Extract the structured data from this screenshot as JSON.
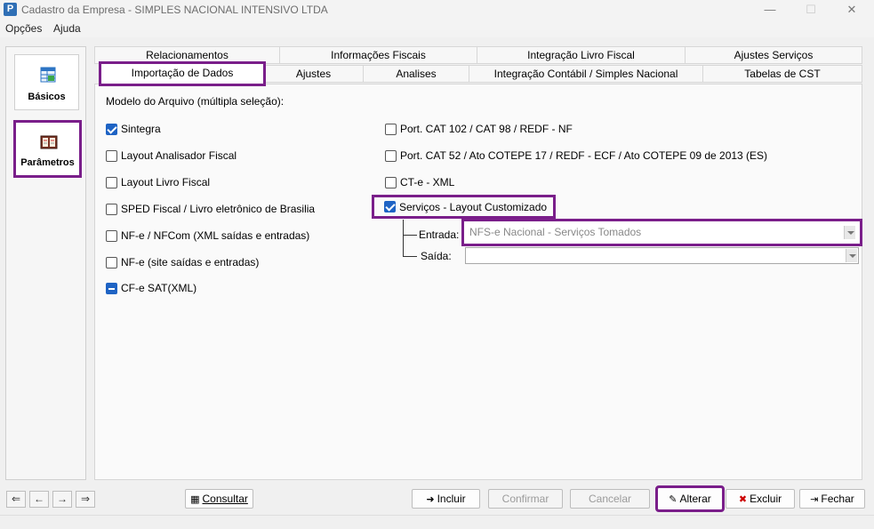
{
  "window": {
    "title": "Cadastro da Empresa - SIMPLES NACIONAL INTENSIVO LTDA",
    "app_icon_letter": "P",
    "minimize": "—",
    "maximize": "☐",
    "close": "✕"
  },
  "menu": {
    "items": [
      "Opções",
      "Ajuda"
    ]
  },
  "sidebar": {
    "items": [
      {
        "label": "Básicos",
        "icon": "spreadsheet-icon"
      },
      {
        "label": "Parâmetros",
        "icon": "book-icon"
      }
    ]
  },
  "tabs": {
    "row1": [
      "Relacionamentos",
      "Informações Fiscais",
      "Integração Livro Fiscal",
      "Ajustes Serviços"
    ],
    "row2": [
      "Importação de Dados",
      "Ajustes",
      "Analises",
      "Integração Contábil / Simples Nacional",
      "Tabelas de CST"
    ],
    "active": "Importação de Dados"
  },
  "import": {
    "section_title": "Modelo do Arquivo (múltipla seleção):",
    "left_options": [
      {
        "label": "Sintegra",
        "state": "checked"
      },
      {
        "label": "Layout Analisador Fiscal",
        "state": "unchecked"
      },
      {
        "label": "Layout Livro Fiscal",
        "state": "unchecked"
      },
      {
        "label": "SPED Fiscal / Livro eletrônico de Brasilia",
        "state": "unchecked"
      },
      {
        "label": "NF-e / NFCom (XML saídas e entradas)",
        "state": "unchecked"
      },
      {
        "label": "NF-e (site saídas e entradas)",
        "state": "unchecked"
      },
      {
        "label": "CF-e SAT(XML)",
        "state": "indeterminate"
      }
    ],
    "right_options": [
      {
        "label": "Port. CAT 102 / CAT 98 / REDF - NF",
        "state": "unchecked"
      },
      {
        "label": "Port. CAT 52 / Ato COTEPE 17 / REDF - ECF / Ato COTEPE 09 de 2013 (ES)",
        "state": "unchecked"
      },
      {
        "label": "CT-e - XML",
        "state": "unchecked"
      },
      {
        "label": "Serviços - Layout Customizado",
        "state": "checked"
      }
    ],
    "entrada_label": "Entrada:",
    "entrada_value": "NFS-e Nacional - Serviços Tomados",
    "saida_label": "Saída:",
    "saida_value": ""
  },
  "bottom": {
    "nav": [
      "first-icon",
      "prev-icon",
      "next-icon",
      "last-icon"
    ],
    "consultar": "Consultar",
    "incluir": "Incluir",
    "confirmar": "Confirmar",
    "cancelar": "Cancelar",
    "alterar": "Alterar",
    "excluir": "Excluir",
    "fechar": "Fechar"
  },
  "colors": {
    "highlight": "#7a1e8a",
    "checkbox_blue": "#1e63c4"
  }
}
